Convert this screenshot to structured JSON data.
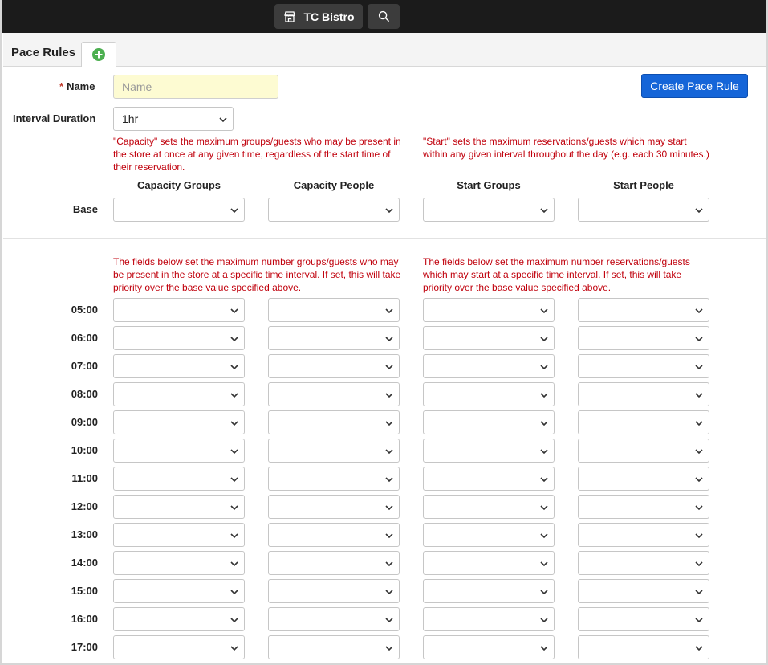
{
  "topbar": {
    "store_name": "TC Bistro",
    "store_icon": "store-icon",
    "search_icon": "search-icon"
  },
  "tabs": {
    "title": "Pace Rules",
    "add_icon": "plus-circle-icon",
    "add_color": "#4caf50"
  },
  "form": {
    "name_label": "Name",
    "name_required": "*",
    "name_placeholder": "Name",
    "name_value": "",
    "create_button": "Create Pace Rule",
    "interval_label": "Interval Duration",
    "interval_value": "1hr",
    "capacity_note": "\"Capacity\" sets the maximum groups/guests who may be present in the store at once at any given time, regardless of the start time of their reservation.",
    "start_note": "\"Start\" sets the maximum reservations/guests which may start within any given interval throughout the day (e.g. each 30 minutes.)",
    "columns": [
      "Capacity Groups",
      "Capacity People",
      "Start Groups",
      "Start People"
    ],
    "base_label": "Base",
    "capacity_override_note": "The fields below set the maximum number groups/guests who may be present in the store at a specific time interval. If set, this will take priority over the base value specified above.",
    "start_override_note": "The fields below set the maximum number reservations/guests which may start at a specific time interval. If set, this will take priority over the base value specified above.",
    "times": [
      "05:00",
      "06:00",
      "07:00",
      "08:00",
      "09:00",
      "10:00",
      "11:00",
      "12:00",
      "13:00",
      "14:00",
      "15:00",
      "16:00",
      "17:00"
    ]
  },
  "colors": {
    "topbar": "#1b1b1b",
    "accent": "#1565d8",
    "note": "#c0000c",
    "name_input_bg": "#fdfbd2"
  }
}
